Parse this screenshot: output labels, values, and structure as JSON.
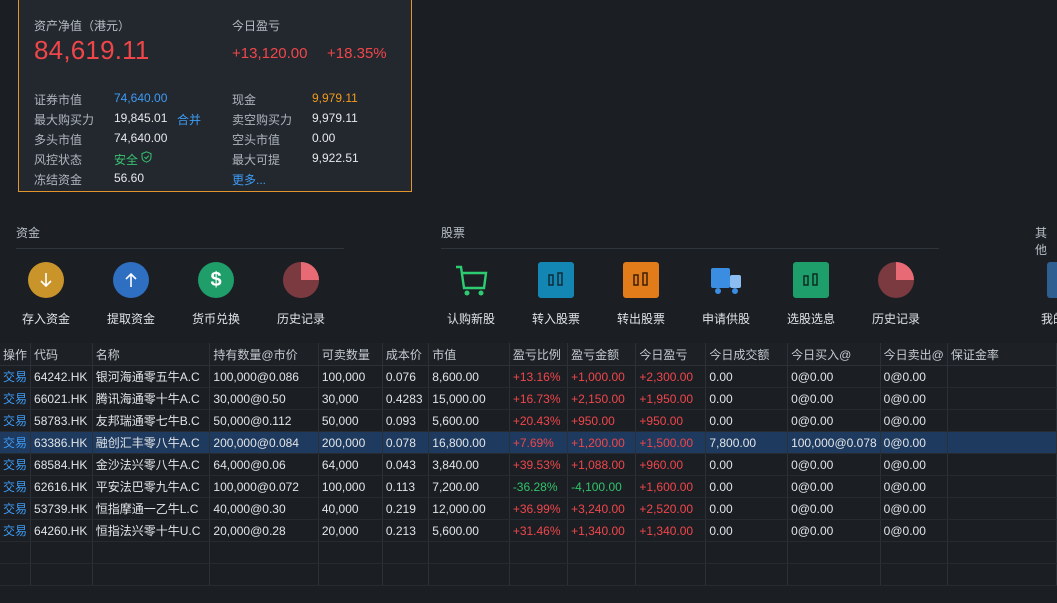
{
  "asset": {
    "nav_label": "资产净值（港元）",
    "nav_value": "84,619.11",
    "today_pnl_label": "今日盈亏",
    "today_pnl": "+13,120.00",
    "today_pnl_pct": "+18.35%",
    "rows": [
      {
        "l1": "证券市值",
        "v1": "74,640.00",
        "l2": "现金",
        "v2": "9,979.11"
      },
      {
        "l1": "最大购买力",
        "v1": "19,845.01",
        "extra": "合并",
        "l2": "卖空购买力",
        "v2": "9,979.11"
      },
      {
        "l1": "多头市值",
        "v1": "74,640.00",
        "l2": "空头市值",
        "v2": "0.00"
      },
      {
        "l1": "风控状态",
        "v1": "安全",
        "l2": "最大可提",
        "v2": "9,922.51"
      },
      {
        "l1": "冻结资金",
        "v1": "56.60",
        "l2": "更多..."
      }
    ]
  },
  "sections": {
    "funds": "资金",
    "stocks": "股票",
    "other": "其他"
  },
  "tools": [
    {
      "label": "存入资金",
      "icon": "deposit-icon"
    },
    {
      "label": "提取资金",
      "icon": "withdraw-icon"
    },
    {
      "label": "货币兑换",
      "icon": "currency-exchange-icon"
    },
    {
      "label": "历史记录",
      "icon": "history-pie-icon"
    },
    {
      "label": "认购新股",
      "icon": "cart-icon"
    },
    {
      "label": "转入股票",
      "icon": "transfer-in-icon"
    },
    {
      "label": "转出股票",
      "icon": "transfer-out-icon"
    },
    {
      "label": "申请供股",
      "icon": "truck-icon"
    },
    {
      "label": "选股选息",
      "icon": "select-stock-icon"
    },
    {
      "label": "历史记录",
      "icon": "history-pie-icon"
    },
    {
      "label": "我的",
      "icon": "other-icon"
    }
  ],
  "table": {
    "headers": [
      "操作",
      "代码",
      "名称",
      "持有数量@市价",
      "可卖数量",
      "成本价",
      "市值",
      "盈亏比例",
      "盈亏金额",
      "今日盈亏",
      "今日成交额",
      "今日买入@",
      "今日卖出@",
      "保证金率"
    ],
    "rows": [
      [
        "交易",
        "64242.HK",
        "银河海通零五牛A.C",
        "100,000@0.086",
        "100,000",
        "0.076",
        "8,600.00",
        "+13.16%",
        "+1,000.00",
        "+2,300.00",
        "0.00",
        "0@0.00",
        "0@0.00",
        ""
      ],
      [
        "交易",
        "66021.HK",
        "腾讯海通零十牛A.C",
        "30,000@0.50",
        "30,000",
        "0.4283",
        "15,000.00",
        "+16.73%",
        "+2,150.00",
        "+1,950.00",
        "0.00",
        "0@0.00",
        "0@0.00",
        ""
      ],
      [
        "交易",
        "58783.HK",
        "友邦瑞通零七牛B.C",
        "50,000@0.112",
        "50,000",
        "0.093",
        "5,600.00",
        "+20.43%",
        "+950.00",
        "+950.00",
        "0.00",
        "0@0.00",
        "0@0.00",
        ""
      ],
      [
        "交易",
        "63386.HK",
        "融创汇丰零八牛A.C",
        "200,000@0.084",
        "200,000",
        "0.078",
        "16,800.00",
        "+7.69%",
        "+1,200.00",
        "+1,500.00",
        "7,800.00",
        "100,000@0.078",
        "0@0.00",
        ""
      ],
      [
        "交易",
        "68584.HK",
        "金沙法兴零八牛A.C",
        "64,000@0.06",
        "64,000",
        "0.043",
        "3,840.00",
        "+39.53%",
        "+1,088.00",
        "+960.00",
        "0.00",
        "0@0.00",
        "0@0.00",
        ""
      ],
      [
        "交易",
        "62616.HK",
        "平安法巴零九牛A.C",
        "100,000@0.072",
        "100,000",
        "0.113",
        "7,200.00",
        "-36.28%",
        "-4,100.00",
        "+1,600.00",
        "0.00",
        "0@0.00",
        "0@0.00",
        ""
      ],
      [
        "交易",
        "53739.HK",
        "恒指摩通一乙牛L.C",
        "40,000@0.30",
        "40,000",
        "0.219",
        "12,000.00",
        "+36.99%",
        "+3,240.00",
        "+2,520.00",
        "0.00",
        "0@0.00",
        "0@0.00",
        ""
      ],
      [
        "交易",
        "64260.HK",
        "恒指法兴零十牛U.C",
        "20,000@0.28",
        "20,000",
        "0.213",
        "5,600.00",
        "+31.46%",
        "+1,340.00",
        "+1,340.00",
        "0.00",
        "0@0.00",
        "0@0.00",
        ""
      ]
    ]
  }
}
